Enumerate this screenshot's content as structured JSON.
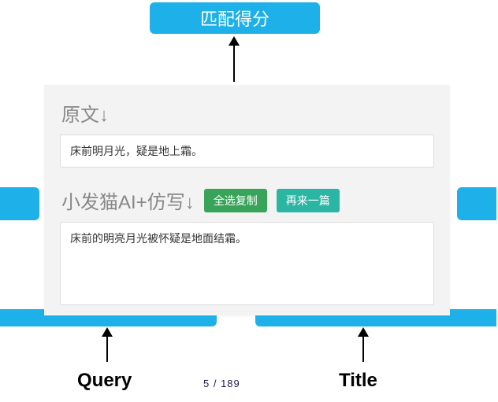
{
  "top_box": "匹配得分",
  "panel": {
    "original_label": "原文↓",
    "original_text": "床前明月光，疑是地上霜。",
    "rewrite_label": "小发猫AI+仿写↓",
    "rewrite_text": "床前的明亮月光被怀疑是地面结霜。",
    "btn_copy": "全选复制",
    "btn_again": "再来一篇"
  },
  "labels": {
    "query": "Query",
    "title": "Title"
  },
  "pager": "5 / 189"
}
